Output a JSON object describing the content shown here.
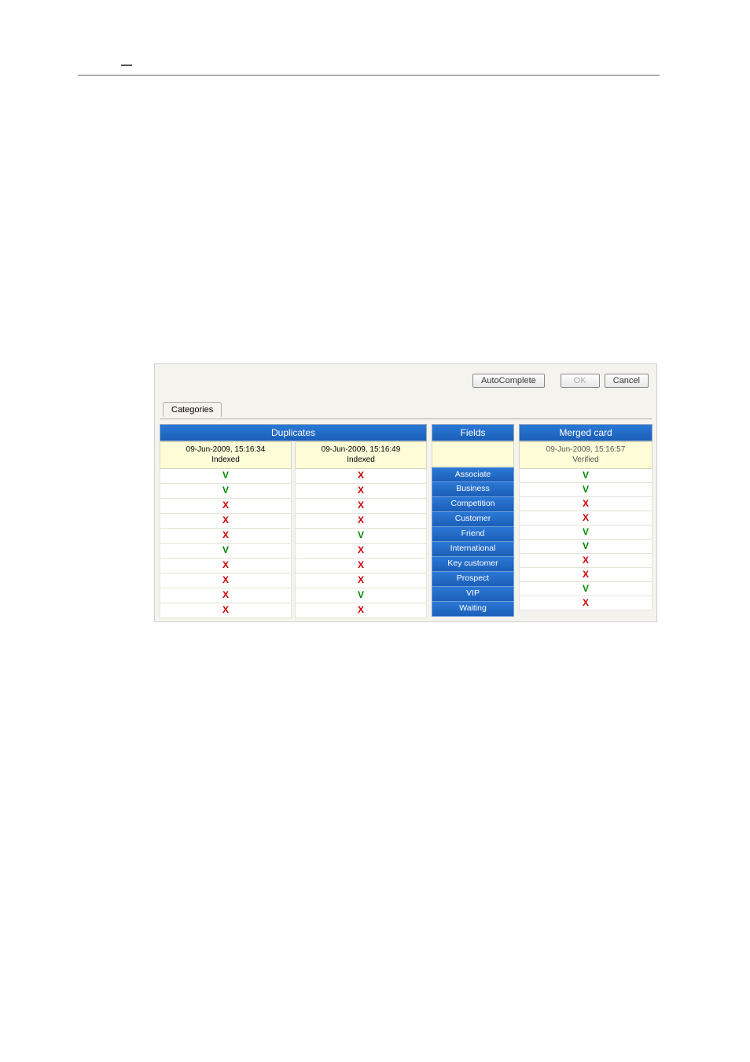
{
  "header_tick": "—",
  "buttons": {
    "autocomplete": "AutoComplete",
    "ok": "OK",
    "cancel": "Cancel"
  },
  "tab": {
    "label": "Categories"
  },
  "columns": {
    "duplicates": "Duplicates",
    "fields": "Fields",
    "merged": "Merged card"
  },
  "dup_sources": [
    {
      "ts": "09-Jun-2009, 15:16:34",
      "status": "Indexed"
    },
    {
      "ts": "09-Jun-2009, 15:16:49",
      "status": "Indexed"
    }
  ],
  "merged_source": {
    "ts": "09-Jun-2009, 15:16:57",
    "status": "Verified"
  },
  "fields": [
    "Associate",
    "Business",
    "Competition",
    "Customer",
    "Friend",
    "International",
    "Key customer",
    "Prospect",
    "VIP",
    "Waiting"
  ],
  "dup_values": {
    "col0": [
      "V",
      "V",
      "X",
      "X",
      "X",
      "V",
      "X",
      "X",
      "X",
      "X"
    ],
    "col1": [
      "X",
      "X",
      "X",
      "X",
      "V",
      "X",
      "X",
      "X",
      "V",
      "X"
    ]
  },
  "merged_values": [
    "V",
    "V",
    "X",
    "X",
    "V",
    "V",
    "X",
    "X",
    "V",
    "X"
  ]
}
